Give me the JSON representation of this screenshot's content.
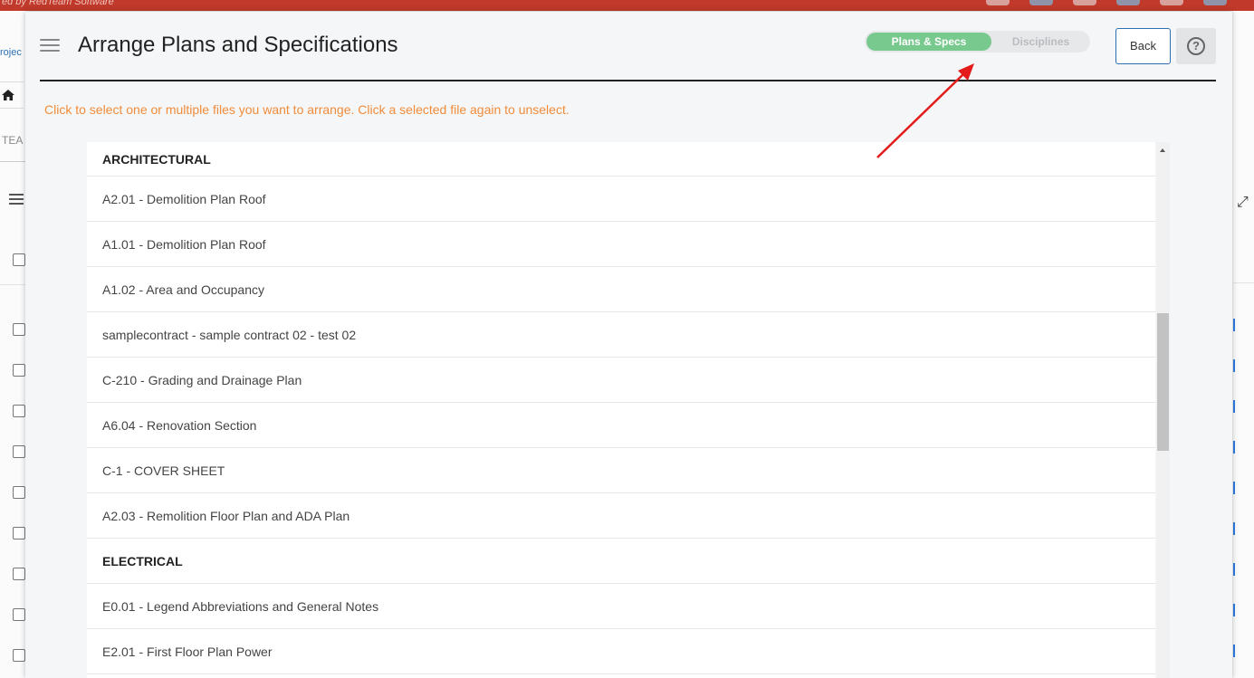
{
  "background": {
    "brand_text": "ed by RedTeam Software",
    "projects_link": "rojec",
    "tab_fragment": "TEA"
  },
  "modal": {
    "title": "Arrange Plans and Specifications",
    "toggle": {
      "active": "Plans & Specs",
      "inactive": "Disciplines"
    },
    "back_label": "Back",
    "help_symbol": "?",
    "instructions": "Click to select one or multiple files you want to arrange. Click a selected file again to unselect."
  },
  "list": {
    "groups": [
      {
        "name": "ARCHITECTURAL",
        "items": [
          "A2.01 - Demolition Plan Roof",
          "A1.01 - Demolition Plan Roof",
          "A1.02 - Area and Occupancy",
          "samplecontract - sample contract 02 - test 02",
          "C-210 - Grading and Drainage Plan",
          "A6.04 - Renovation Section",
          "C-1 - COVER SHEET",
          "A2.03 - Remolition Floor Plan and ADA Plan"
        ]
      },
      {
        "name": "ELECTRICAL",
        "items": [
          "E0.01 - Legend Abbreviations and General Notes",
          "E2.01 - First Floor Plan Power"
        ]
      }
    ]
  },
  "colors": {
    "accent_green": "#78c98e",
    "instruction_orange": "#f08c3a",
    "topbar_red": "#c0392b",
    "annotation_arrow": "#e31b1b"
  }
}
